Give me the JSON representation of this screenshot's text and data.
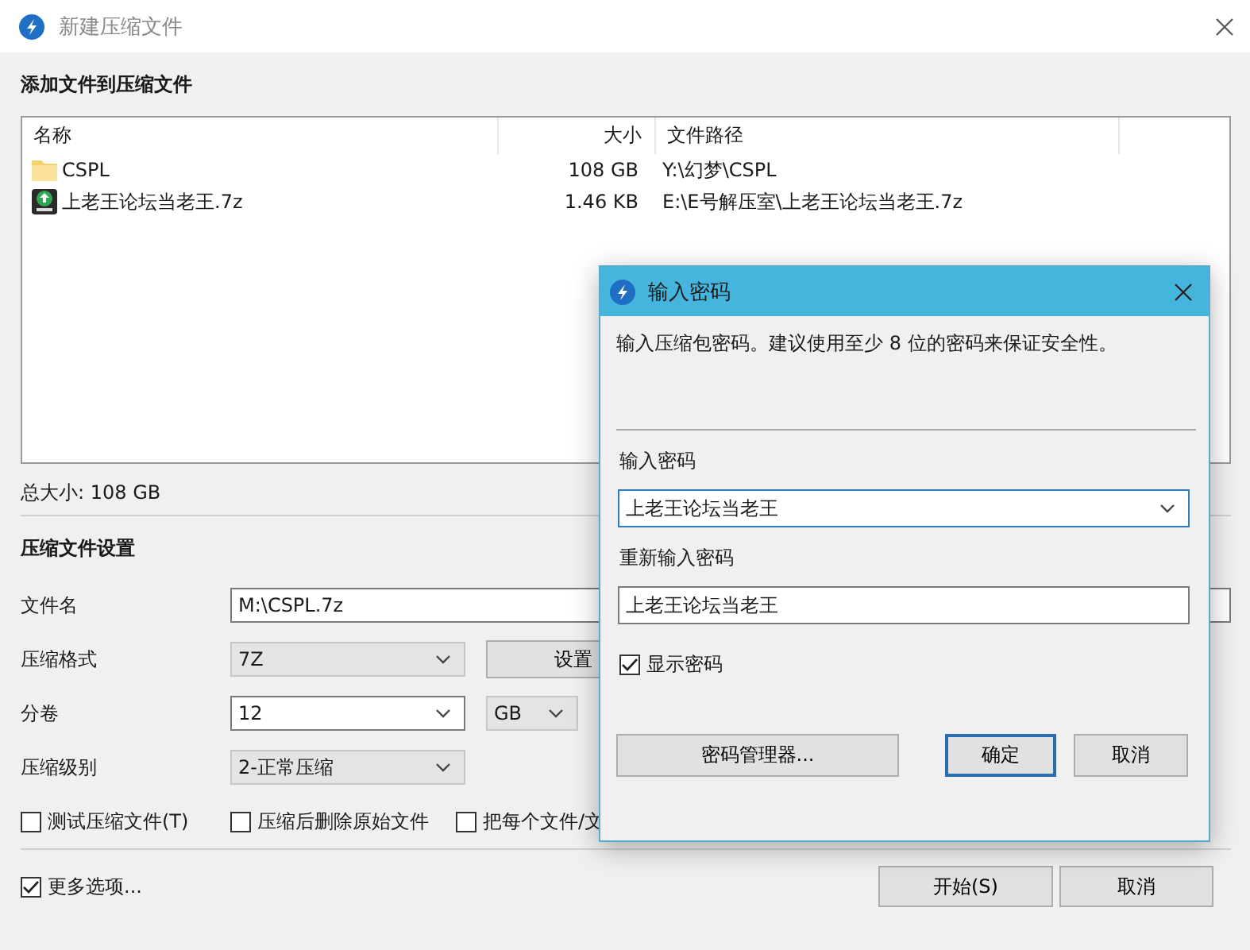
{
  "window": {
    "title": "新建压缩文件"
  },
  "files_section": {
    "heading": "添加文件到压缩文件",
    "columns": [
      "名称",
      "大小",
      "文件路径"
    ],
    "rows": [
      {
        "kind": "folder",
        "name": "CSPL",
        "size": "108 GB",
        "path": "Y:\\幻梦\\CSPL"
      },
      {
        "kind": "archive",
        "name": "上老王论坛当老王.7z",
        "size": "1.46 KB",
        "path": "E:\\E号解压室\\上老王论坛当老王.7z"
      }
    ],
    "total": "总大小: 108 GB"
  },
  "settings": {
    "heading": "压缩文件设置",
    "fields": [
      {
        "kind": "input",
        "label": "文件名",
        "value": "M:\\CSPL.7z"
      },
      {
        "kind": "select",
        "label": "压缩格式",
        "value": "7Z",
        "button": "设置"
      },
      {
        "kind": "combo",
        "label": "分卷",
        "value": "12",
        "unit": "GB"
      },
      {
        "kind": "select",
        "label": "压缩级别",
        "value": "2-正常压缩"
      }
    ],
    "options": [
      {
        "label": "测试压缩文件(T)",
        "checked": false
      },
      {
        "label": "压缩后删除原始文件",
        "checked": false
      },
      {
        "label": "把每个文件/文",
        "checked": false
      }
    ]
  },
  "more_options": {
    "label": "更多选项...",
    "checked": true
  },
  "buttons": [
    "开始(S)",
    "取消"
  ],
  "dialog": {
    "title": "输入密码",
    "description": "输入压缩包密码。建议使用至少 8 位的密码来保证安全性。",
    "password_label": "输入密码",
    "password": "上老王论坛当老王",
    "confirm_label": "重新输入密码",
    "confirm": "上老王论坛当老王",
    "show_password": {
      "label": "显示密码",
      "checked": true
    },
    "buttons": [
      {
        "label": "密码管理器...",
        "default": false
      },
      {
        "label": "确定",
        "default": true
      },
      {
        "label": "取消",
        "default": false
      }
    ]
  }
}
